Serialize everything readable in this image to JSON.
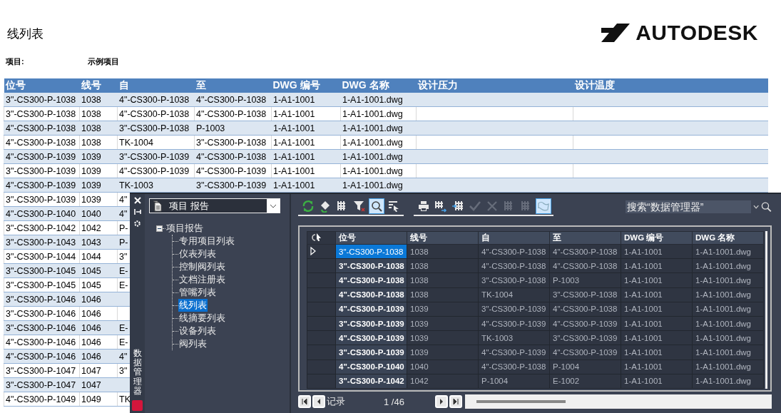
{
  "report": {
    "title": "线列表",
    "project_label": "项目:",
    "project_value": "示例项目",
    "logo": "AUTODESK"
  },
  "report_table": {
    "columns": [
      "位号",
      "线号",
      "自",
      "至",
      "DWG 编号",
      "DWG 名称",
      "设计压力",
      "设计温度"
    ],
    "rows": [
      {
        "cells": [
          "3\"-CS300-P-1038",
          "1038",
          "4\"-CS300-P-1038",
          "4\"-CS300-P-1038",
          "1-A1-1001",
          "1-A1-1001.dwg"
        ]
      },
      {
        "cells": [
          "3\"-CS300-P-1038",
          "1038",
          "4\"-CS300-P-1038",
          "4\"-CS300-P-1038",
          "1-A1-1001",
          "1-A1-1001.dwg"
        ]
      },
      {
        "cells": [
          "4\"-CS300-P-1038",
          "1038",
          "3\"-CS300-P-1038",
          "P-1003",
          "1-A1-1001",
          "1-A1-1001.dwg"
        ]
      },
      {
        "cells": [
          "4\"-CS300-P-1038",
          "1038",
          "TK-1004",
          "3\"-CS300-P-1038",
          "1-A1-1001",
          "1-A1-1001.dwg"
        ]
      },
      {
        "cells": [
          "4\"-CS300-P-1039",
          "1039",
          "3\"-CS300-P-1039",
          "4\"-CS300-P-1038",
          "1-A1-1001",
          "1-A1-1001.dwg"
        ]
      },
      {
        "cells": [
          "3\"-CS300-P-1039",
          "1039",
          "4\"-CS300-P-1039",
          "4\"-CS300-P-1039",
          "1-A1-1001",
          "1-A1-1001.dwg"
        ]
      },
      {
        "cells": [
          "4\"-CS300-P-1039",
          "1039",
          "TK-1003",
          "3\"-CS300-P-1039",
          "1-A1-1001",
          "1-A1-1001.dwg"
        ]
      },
      {
        "cells": [
          "3\"-CS300-P-1039",
          "1039",
          "4\""
        ]
      },
      {
        "cells": [
          "4\"-CS300-P-1040",
          "1040",
          "4\""
        ]
      },
      {
        "cells": [
          "3\"-CS300-P-1042",
          "1042",
          "P-"
        ]
      },
      {
        "cells": [
          "3\"-CS300-P-1043",
          "1043",
          "P-"
        ]
      },
      {
        "cells": [
          "3\"-CS300-P-1044",
          "1044",
          "3\""
        ]
      },
      {
        "cells": [
          "3\"-CS300-P-1045",
          "1045",
          "E-"
        ]
      },
      {
        "cells": [
          "3\"-CS300-P-1045",
          "1045",
          "E-"
        ]
      },
      {
        "cells": [
          "3\"-CS300-P-1046",
          "1046"
        ]
      },
      {
        "cells": [
          "3\"-CS300-P-1046",
          "1046"
        ]
      },
      {
        "cells": [
          "3\"-CS300-P-1046",
          "1046",
          "E-"
        ]
      },
      {
        "cells": [
          "4\"-CS300-P-1046",
          "1046",
          "E-"
        ]
      },
      {
        "cells": [
          "4\"-CS300-P-1046",
          "1046",
          "4\""
        ]
      },
      {
        "cells": [
          "3\"-CS300-P-1047",
          "1047",
          "3\""
        ]
      },
      {
        "cells": [
          "3\"-CS300-P-1047",
          "1047"
        ]
      },
      {
        "cells": [
          "4\"-CS300-P-1049",
          "1049",
          "TK"
        ]
      }
    ]
  },
  "data_manager": {
    "title": "数据管理器",
    "dropdown": "项目 报告",
    "tree": {
      "label": "项目报告",
      "expanded": true,
      "children": [
        {
          "label": "专用项目列表",
          "selected": false
        },
        {
          "label": "仪表列表",
          "selected": false
        },
        {
          "label": "控制阀列表",
          "selected": false
        },
        {
          "label": "文档注册表",
          "selected": false
        },
        {
          "label": "管嘴列表",
          "selected": false
        },
        {
          "label": "线列表",
          "selected": true
        },
        {
          "label": "线摘要列表",
          "selected": false
        },
        {
          "label": "设备列表",
          "selected": false
        },
        {
          "label": "阀列表",
          "selected": false
        }
      ]
    },
    "toolbar_groups": [
      [
        {
          "kind": "refresh",
          "active": false,
          "disabled": false
        },
        {
          "kind": "sync",
          "active": false,
          "disabled": false
        },
        {
          "kind": "columns",
          "active": false,
          "disabled": false
        },
        {
          "kind": "filter",
          "active": false,
          "disabled": false
        },
        {
          "kind": "zoom",
          "active": true,
          "disabled": false
        },
        {
          "kind": "select",
          "active": false,
          "disabled": false
        }
      ],
      [
        {
          "kind": "print",
          "active": false,
          "disabled": false
        },
        {
          "kind": "export",
          "active": false,
          "disabled": false
        },
        {
          "kind": "import",
          "active": false,
          "disabled": false
        },
        {
          "kind": "accept",
          "active": false,
          "disabled": true
        },
        {
          "kind": "reject",
          "active": false,
          "disabled": true
        },
        {
          "kind": "columns",
          "active": false,
          "disabled": true
        },
        {
          "kind": "columns",
          "active": false,
          "disabled": true
        },
        {
          "kind": "map",
          "active": true,
          "disabled": false
        }
      ]
    ],
    "search": {
      "placeholder": "搜索“数据管理器”"
    },
    "grid": {
      "columns": [
        "位号",
        "线号",
        "自",
        "至",
        "DWG 编号",
        "DWG 名称"
      ],
      "rows": [
        {
          "selected": true,
          "cells": [
            "3\"-CS300-P-1038",
            "1038",
            "4\"-CS300-P-1038",
            "4\"-CS300-P-1038",
            "1-A1-1001",
            "1-A1-1001.dwg"
          ]
        },
        {
          "selected": false,
          "cells": [
            "3\"-CS300-P-1038",
            "1038",
            "4\"-CS300-P-1038",
            "4\"-CS300-P-1038",
            "1-A1-1001",
            "1-A1-1001.dwg"
          ]
        },
        {
          "selected": false,
          "cells": [
            "4\"-CS300-P-1038",
            "1038",
            "3\"-CS300-P-1038",
            "P-1003",
            "1-A1-1001",
            "1-A1-1001.dwg"
          ]
        },
        {
          "selected": false,
          "cells": [
            "4\"-CS300-P-1038",
            "1038",
            "TK-1004",
            "3\"-CS300-P-1038",
            "1-A1-1001",
            "1-A1-1001.dwg"
          ]
        },
        {
          "selected": false,
          "cells": [
            "4\"-CS300-P-1039",
            "1039",
            "3\"-CS300-P-1039",
            "4\"-CS300-P-1038",
            "1-A1-1001",
            "1-A1-1001.dwg"
          ]
        },
        {
          "selected": false,
          "cells": [
            "3\"-CS300-P-1039",
            "1039",
            "4\"-CS300-P-1039",
            "4\"-CS300-P-1039",
            "1-A1-1001",
            "1-A1-1001.dwg"
          ]
        },
        {
          "selected": false,
          "cells": [
            "4\"-CS300-P-1039",
            "1039",
            "TK-1003",
            "3\"-CS300-P-1039",
            "1-A1-1001",
            "1-A1-1001.dwg"
          ]
        },
        {
          "selected": false,
          "cells": [
            "3\"-CS300-P-1039",
            "1039",
            "4\"-CS300-P-1039",
            "4\"-CS300-P-1039",
            "1-A1-1001",
            "1-A1-1001.dwg"
          ]
        },
        {
          "selected": false,
          "cells": [
            "4\"-CS300-P-1040",
            "1040",
            "4\"-CS300-P-1038",
            "P-1004",
            "1-A1-1001",
            "1-A1-1001.dwg"
          ]
        },
        {
          "selected": false,
          "cells": [
            "3\"-CS300-P-1042",
            "1042",
            "P-1004",
            "E-1002",
            "1-A1-1001",
            "1-A1-1001.dwg"
          ]
        }
      ]
    },
    "pager": {
      "label": "记录",
      "position": "1 /46"
    }
  }
}
